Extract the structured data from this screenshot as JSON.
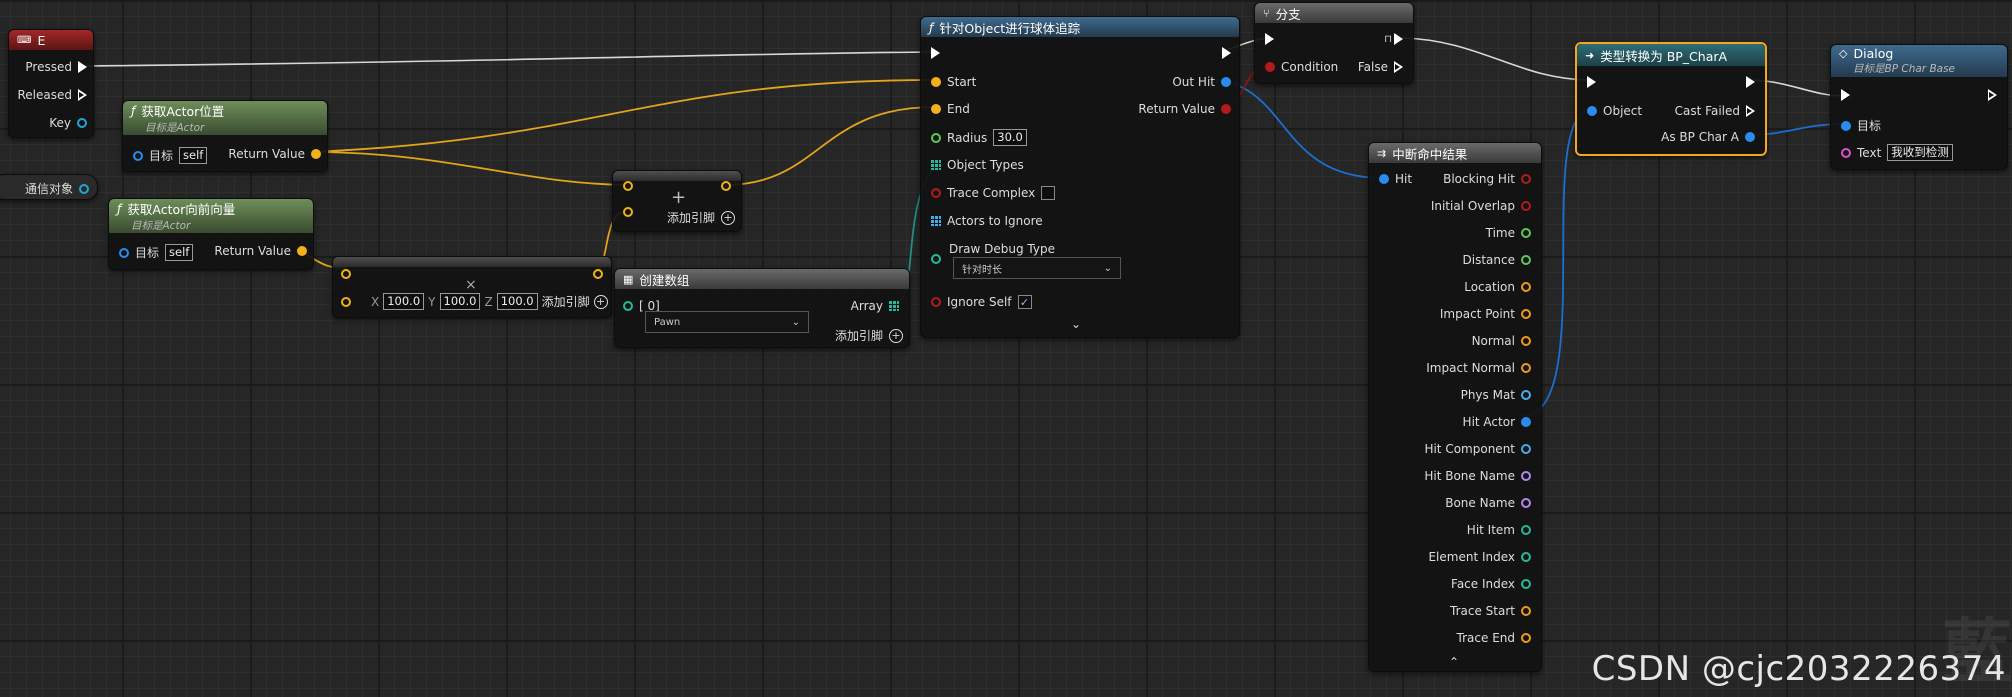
{
  "nodes": {
    "key_e": {
      "title": "E",
      "pins": {
        "pressed": "Pressed",
        "released": "Released",
        "key": "Key"
      }
    },
    "get_location": {
      "title": "获取Actor位置",
      "subtitle": "目标是Actor",
      "target_label": "目标",
      "target_value": "self",
      "return_label": "Return Value"
    },
    "comm_object": {
      "label": "通信对象"
    },
    "get_forward": {
      "title": "获取Actor向前向量",
      "subtitle": "目标是Actor",
      "target_label": "目标",
      "target_value": "self",
      "return_label": "Return Value"
    },
    "add_node": {
      "add_pin": "添加引脚"
    },
    "multiply_node": {
      "x_label": "X",
      "x_value": "100.0",
      "y_label": "Y",
      "y_value": "100.0",
      "z_label": "Z",
      "z_value": "100.0",
      "add_pin": "添加引脚"
    },
    "make_array": {
      "title": "创建数组",
      "index": "[ 0]",
      "dropdown": "Pawn",
      "array_label": "Array",
      "add_pin": "添加引脚"
    },
    "sphere_trace": {
      "title": "针对Object进行球体追踪",
      "start": "Start",
      "end": "End",
      "radius": "Radius",
      "radius_value": "30.0",
      "object_types": "Object Types",
      "trace_complex": "Trace Complex",
      "actors_to_ignore": "Actors to Ignore",
      "draw_debug_type": "Draw Debug Type",
      "draw_debug_value": "针对时长",
      "ignore_self": "Ignore Self",
      "out_hit": "Out Hit",
      "return_value": "Return Value"
    },
    "branch": {
      "title": "分支",
      "condition": "Condition",
      "false_label": "False"
    },
    "break_hit": {
      "title": "中断命中结果",
      "hit": "Hit",
      "outputs": [
        "Blocking Hit",
        "Initial Overlap",
        "Time",
        "Distance",
        "Location",
        "Impact Point",
        "Normal",
        "Impact Normal",
        "Phys Mat",
        "Hit Actor",
        "Hit Component",
        "Hit Bone Name",
        "Bone Name",
        "Hit Item",
        "Element Index",
        "Face Index",
        "Trace Start",
        "Trace End"
      ]
    },
    "cast": {
      "title": "类型转换为 BP_CharA",
      "object": "Object",
      "cast_failed": "Cast Failed",
      "as_bp": "As BP Char A"
    },
    "dialog": {
      "title": "Dialog",
      "subtitle": "目标是BP Char Base",
      "target_label": "目标",
      "text_label": "Text",
      "text_value": "我收到检测"
    }
  },
  "watermark": "CSDN @cjc2032226374",
  "colors": {
    "exec": "#ffffff",
    "vector": "#f0b11a",
    "object": "#2a8bf0",
    "bool": "#b01c1c",
    "float": "#5ec85a",
    "struct": "#22a4d8",
    "string": "#e050d4",
    "int": "#29b89a",
    "selection": "#f2a81e"
  }
}
